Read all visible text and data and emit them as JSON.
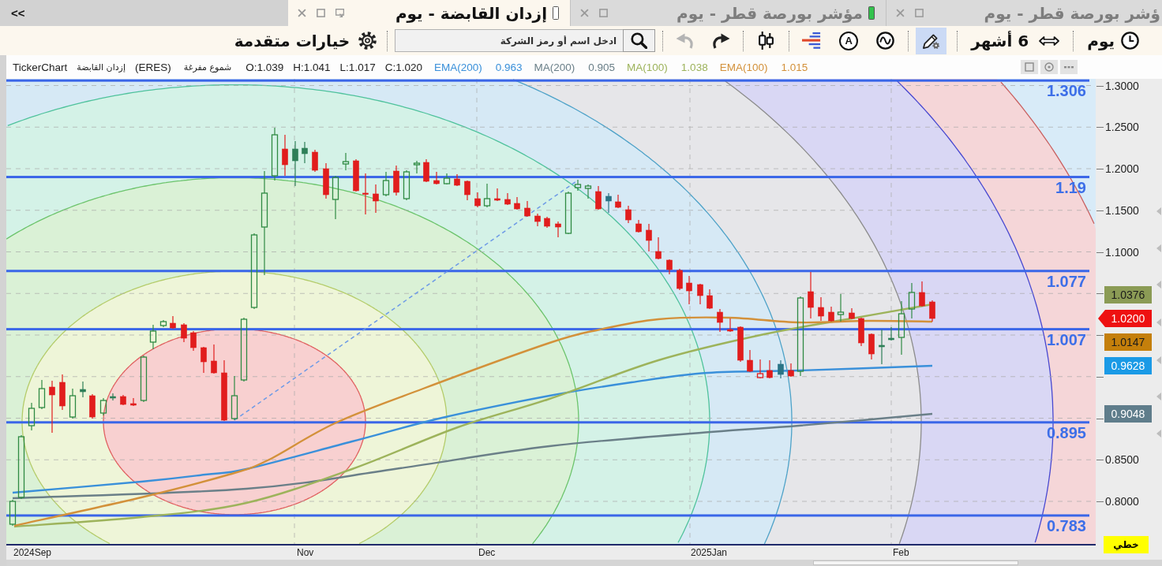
{
  "tab_bar": {
    "collapse_label": "<<",
    "tabs": [
      {
        "title": "ؤشر بورصة قطر - يوم",
        "selected": false
      },
      {
        "title": "مؤشر بورصة قطر - يوم",
        "selected": false,
        "color": "#33c24d"
      },
      {
        "title": "إزدان القابضة - يوم",
        "selected": true,
        "color": "#ffffff"
      }
    ]
  },
  "toolbar": {
    "interval": "يوم",
    "period": "6 أشهر",
    "tool_groups": [
      [
        {
          "kind": "draw",
          "selected": true
        }
      ],
      [
        {
          "kind": "oscillator",
          "selected": false
        },
        {
          "kind": "annotation",
          "glyph": "A",
          "selected": false
        },
        {
          "kind": "volume-profile",
          "selected": false
        }
      ],
      [
        {
          "kind": "candles",
          "selected": false
        }
      ]
    ],
    "history": [
      {
        "kind": "redo",
        "disabled": false
      },
      {
        "kind": "undo",
        "disabled": true
      }
    ],
    "search": {
      "placeholder": "ادخل اسم أو رمز الشركة"
    },
    "advanced": "خيارات متقدمة"
  },
  "chart": {
    "legend": {
      "source": "TickerChart",
      "symbol": "إزدان القابضة",
      "code": "(ERES)",
      "style": "شموع مفرغة",
      "ohlc": [
        "O:1.039",
        "H:1.041",
        "L:1.017",
        "C:1.020"
      ],
      "indicators": [
        {
          "name": "EMA(200)",
          "value": "0.963",
          "color": "#3a90da"
        },
        {
          "name": "MA(200)",
          "value": "0.905",
          "color": "#6a7f88"
        },
        {
          "name": "MA(100)",
          "value": "1.038",
          "color": "#9db35b"
        },
        {
          "name": "EMA(100)",
          "value": "1.015",
          "color": "#d3913a"
        }
      ]
    },
    "fib_levels": [
      "1.306",
      "1.19",
      "1.077",
      "1.007",
      "0.895",
      "0.783"
    ],
    "y_axis": [
      "1.3000",
      "1.2500",
      "1.2000",
      "1.1500",
      "1.1000",
      "0.8500",
      "0.8000"
    ],
    "price_tags": [
      {
        "kind": "indicator",
        "text": "1.0376",
        "color": "#8b9b55"
      },
      {
        "kind": "last",
        "text": "1.0200",
        "color": "#ee1111"
      },
      {
        "kind": "indicator",
        "text": "1.0147",
        "color": "#c47f0b"
      },
      {
        "kind": "indicator",
        "text": "0.9628",
        "color": "#1a9ae6"
      },
      {
        "kind": "indicator",
        "text": "0.9048",
        "color": "#5f7d8b"
      }
    ],
    "x_axis": [
      "2024Sep",
      "Nov",
      "Dec",
      "2025Jan",
      "Feb"
    ],
    "scale_label": "خطي"
  }
}
